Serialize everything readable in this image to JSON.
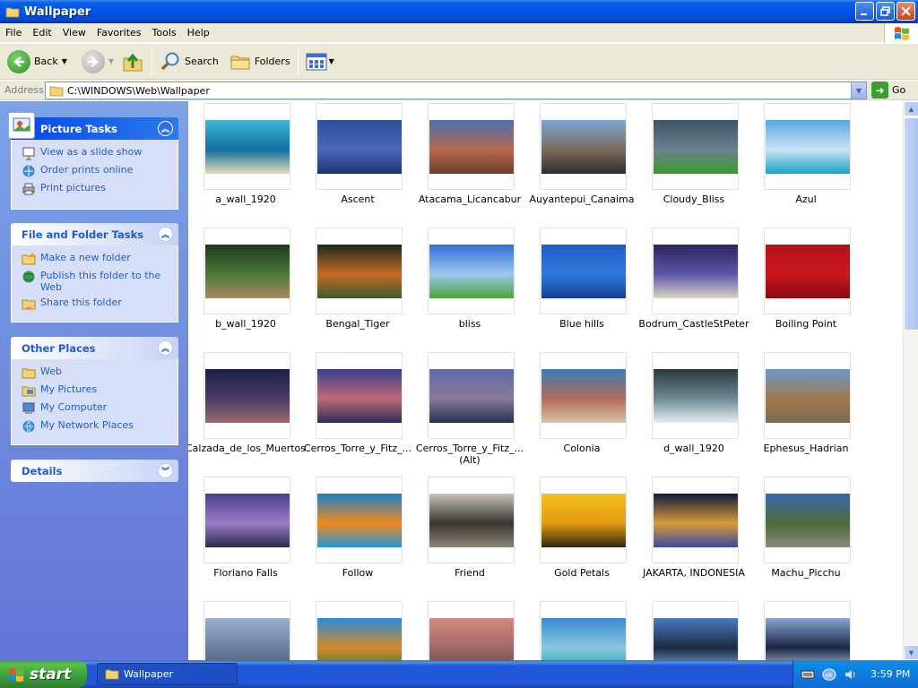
{
  "window": {
    "title": "Wallpaper",
    "icon": "folder-icon",
    "controls": [
      "minimize",
      "maximize",
      "close"
    ]
  },
  "menubar": [
    "File",
    "Edit",
    "View",
    "Favorites",
    "Tools",
    "Help"
  ],
  "toolbar": {
    "back_label": "Back",
    "search_label": "Search",
    "folders_label": "Folders"
  },
  "address": {
    "label": "Address",
    "path": "C:\\WINDOWS\\Web\\Wallpaper",
    "go_label": "Go"
  },
  "taskpane": {
    "picture_tasks": {
      "title": "Picture Tasks",
      "items": [
        "View as a slide show",
        "Order prints online",
        "Print pictures"
      ]
    },
    "file_folder_tasks": {
      "title": "File and Folder Tasks",
      "items": [
        "Make a new folder",
        "Publish this folder to the Web",
        "Share this folder"
      ]
    },
    "other_places": {
      "title": "Other Places",
      "items": [
        "Web",
        "My Pictures",
        "My Computer",
        "My Network Places"
      ]
    },
    "details": {
      "title": "Details"
    }
  },
  "files": [
    {
      "name": "a_wall_1920",
      "colors": [
        "#3fb7d6",
        "#0f6fa0",
        "#e4dbb8"
      ]
    },
    {
      "name": "Ascent",
      "colors": [
        "#2a4f9a",
        "#4b67b9",
        "#1e3470"
      ]
    },
    {
      "name": "Atacama_Licancabur",
      "colors": [
        "#4c6fb0",
        "#b76a4d",
        "#6e3b2a"
      ]
    },
    {
      "name": "Auyantepui_Canaima",
      "colors": [
        "#7aa6d6",
        "#7a6b5a",
        "#2d2d2d"
      ]
    },
    {
      "name": "Cloudy_Bliss",
      "colors": [
        "#3c5466",
        "#6b8190",
        "#3a9b2b"
      ]
    },
    {
      "name": "Azul",
      "colors": [
        "#5aa6e0",
        "#c9e4f5",
        "#1aa3c4"
      ]
    },
    {
      "name": "b_wall_1920",
      "colors": [
        "#1d3a1c",
        "#4b7a38",
        "#a98a61"
      ]
    },
    {
      "name": "Bengal_Tiger",
      "colors": [
        "#1a2a1a",
        "#c76a24",
        "#3a5d2c"
      ]
    },
    {
      "name": "bliss",
      "colors": [
        "#2f6fd3",
        "#9cc8f0",
        "#4aa338"
      ]
    },
    {
      "name": "Blue hills",
      "colors": [
        "#1d5cc7",
        "#2f7ad8",
        "#143f92"
      ]
    },
    {
      "name": "Bodrum_CastleStPeter",
      "colors": [
        "#2b2560",
        "#5d57a8",
        "#d9d2c4"
      ]
    },
    {
      "name": "Boiling Point",
      "colors": [
        "#b5101a",
        "#c8181f",
        "#8a0810"
      ]
    },
    {
      "name": "Calzada_de_los_Muertos",
      "colors": [
        "#1a1f4a",
        "#4a3b66",
        "#9a6b6b"
      ]
    },
    {
      "name": "Cerros_Torre_y_Fitz_...",
      "colors": [
        "#3a3f8a",
        "#c06a78",
        "#2a2e5a"
      ]
    },
    {
      "name": "Cerros_Torre_y_Fitz_... (Alt)",
      "colors": [
        "#5d6aa8",
        "#8a7a9a",
        "#2a3050"
      ]
    },
    {
      "name": "Colonia",
      "colors": [
        "#3d7ab8",
        "#b36b5a",
        "#d6c3a5"
      ]
    },
    {
      "name": "d_wall_1920",
      "colors": [
        "#2a3840",
        "#6f8a94",
        "#e6eef0"
      ]
    },
    {
      "name": "Ephesus_Hadrian",
      "colors": [
        "#6c99c9",
        "#a07a4c",
        "#7a6a52"
      ]
    },
    {
      "name": "Floriano Falls",
      "colors": [
        "#4a3f8a",
        "#9a7bc6",
        "#2a2a50"
      ]
    },
    {
      "name": "Follow",
      "colors": [
        "#1a7fc9",
        "#f28a1a",
        "#2095d9"
      ]
    },
    {
      "name": "Friend",
      "colors": [
        "#c8c3b8",
        "#3a3530",
        "#8a8478"
      ]
    },
    {
      "name": "Gold Petals",
      "colors": [
        "#f3c21a",
        "#e49a12",
        "#2b2a10"
      ]
    },
    {
      "name": "JAKARTA, INDONESIA",
      "colors": [
        "#101a3a",
        "#d89a3a",
        "#3a4aa0"
      ]
    },
    {
      "name": "Machu_Picchu",
      "colors": [
        "#3a6ab0",
        "#4e6a3a",
        "#8a8a80"
      ]
    },
    {
      "name": "",
      "colors": [
        "#9ab0d0",
        "#6b7fa0",
        "#4a5a70"
      ]
    },
    {
      "name": "",
      "colors": [
        "#2a8ad8",
        "#d48a2a",
        "#3a7a3a"
      ]
    },
    {
      "name": "",
      "colors": [
        "#d28a7a",
        "#a06a6a",
        "#6a4a4a"
      ]
    },
    {
      "name": "",
      "colors": [
        "#3a8ad0",
        "#8ac8e0",
        "#2aa0a0"
      ]
    },
    {
      "name": "",
      "colors": [
        "#4a7ac0",
        "#1a2a40",
        "#8aaee0"
      ]
    },
    {
      "name": "",
      "colors": [
        "#8aa6d6",
        "#1a2540",
        "#c8d6ee"
      ]
    }
  ],
  "taskbar": {
    "start_label": "start",
    "open_window": "Wallpaper",
    "clock": "3:59 PM"
  },
  "colors": {
    "titlebar": "#0055e5",
    "taskpane_bg": "#6f8fdd",
    "link_blue": "#215dc6",
    "start_green": "#3c9a3c"
  }
}
